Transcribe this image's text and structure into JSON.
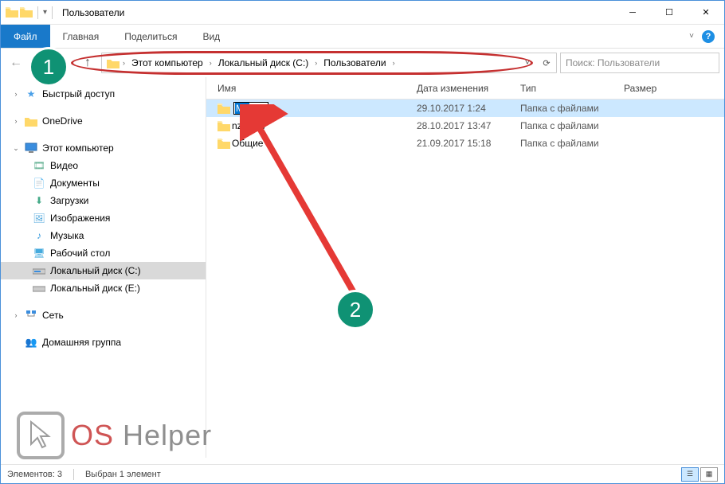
{
  "titlebar": {
    "title": "Пользователи"
  },
  "ribbon": {
    "file": "Файл",
    "tabs": [
      "Главная",
      "Поделиться",
      "Вид"
    ]
  },
  "breadcrumb": [
    "Этот компьютер",
    "Локальный диск (C:)",
    "Пользователи"
  ],
  "search": {
    "placeholder": "Поиск: Пользователи"
  },
  "sidebar": {
    "quick": "Быстрый доступ",
    "onedrive": "OneDrive",
    "thispc": "Этот компьютер",
    "children": [
      "Видео",
      "Документы",
      "Загрузки",
      "Изображения",
      "Музыка",
      "Рабочий стол",
      "Локальный диск (C:)",
      "Локальный диск (E:)"
    ],
    "network": "Сеть",
    "homegroup": "Домашняя группа"
  },
  "columns": {
    "name": "Имя",
    "date": "Дата изменения",
    "type": "Тип",
    "size": "Размер"
  },
  "rows": [
    {
      "name_edit": "My",
      "date": "29.10.2017 1:24",
      "type": "Папка с файлами"
    },
    {
      "name": "nzhorov",
      "date": "28.10.2017 13:47",
      "type": "Папка с файлами"
    },
    {
      "name": "Общие",
      "date": "21.09.2017 15:18",
      "type": "Папка с файлами"
    }
  ],
  "status": {
    "count": "Элементов: 3",
    "selected": "Выбран 1 элемент"
  },
  "annotations": {
    "b1": "1",
    "b2": "2"
  },
  "logo": {
    "os": "OS",
    "helper": "Helper"
  }
}
